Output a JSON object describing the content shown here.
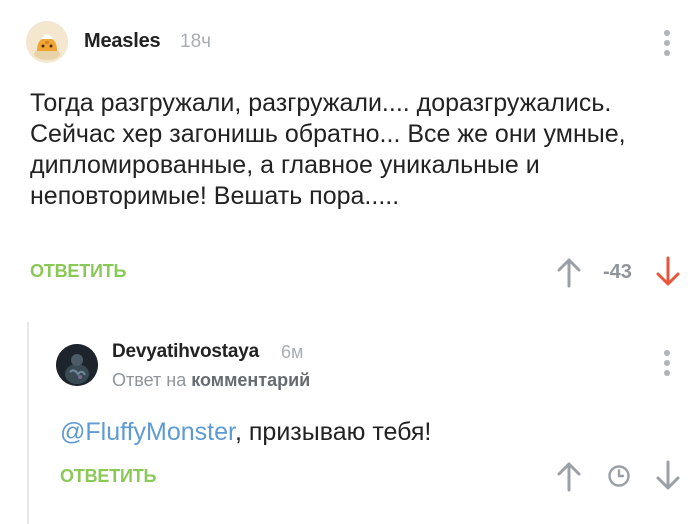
{
  "comments": [
    {
      "author": "Measles",
      "time": "18ч",
      "text": "Тогда разгружали, разгружали.... доразгружались. Сейчас хер загонишь обратно... Все же они умные, дипломированные, а главное уникальные и неповторимые! Вешать пора.....",
      "reply_label": "ОТВЕТИТЬ",
      "rating": "-43",
      "avatar_icon": "avatar-bun-icon"
    },
    {
      "author": "Devyatihvostaya",
      "time": "6м",
      "reply_to_prefix": "Ответ на",
      "reply_to_link": "комментарий",
      "mention": "@FluffyMonster",
      "text_rest": ", призываю тебя!",
      "reply_label": "ОТВЕТИТЬ",
      "avatar_icon": "avatar-photo-icon"
    }
  ],
  "colors": {
    "accent_green": "#8ac858",
    "link_blue": "#5e9ad3",
    "downvote_active": "#e8553d",
    "muted_gray": "#8e9499"
  }
}
